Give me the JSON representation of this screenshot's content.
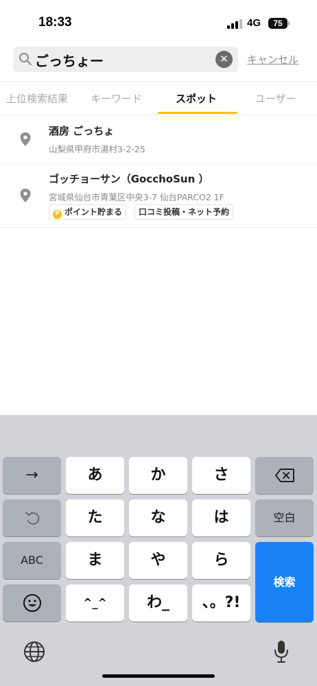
{
  "status_bar": {
    "time": "18:33",
    "network": "4G",
    "battery": "75"
  },
  "search": {
    "query": "ごっちょー",
    "cancel_label": "キャンセル"
  },
  "tabs": [
    {
      "label": "上位検索結果",
      "active": false
    },
    {
      "label": "キーワード",
      "active": false
    },
    {
      "label": "スポット",
      "active": true
    },
    {
      "label": "ユーザー",
      "active": false
    }
  ],
  "results": [
    {
      "title": "酒房 ごっちょ",
      "address": "山梨県甲府市湯村3-2-25",
      "badges": []
    },
    {
      "title": "ゴッチョーサン（GocchoSun ）",
      "address": "宮城県仙台市青葉区中央3-7 仙台PARCO2 1F",
      "badges": [
        "ポイント貯まる",
        "口コミ投稿・ネット予約"
      ]
    }
  ],
  "badge_coin_letter": "P",
  "keyboard": {
    "rows": [
      [
        "→",
        "あ",
        "か",
        "さ",
        "⌫"
      ],
      [
        "↺",
        "た",
        "な",
        "は",
        "空白"
      ],
      [
        "ABC",
        "ま",
        "や",
        "ら",
        "検索"
      ],
      [
        "☺",
        "^_^",
        "わ_",
        "、。?!"
      ]
    ],
    "search_key": "検索",
    "space_key": "空白",
    "abc_key": "ABC"
  },
  "colors": {
    "accent_yellow": "#f5c400",
    "search_key_blue": "#1a82f7",
    "keyboard_bg": "#d1d3d9"
  },
  "icons": [
    "search-icon",
    "clear-icon",
    "location-pin-icon",
    "globe-icon",
    "microphone-icon",
    "backspace-icon",
    "undo-icon",
    "emoji-icon"
  ]
}
